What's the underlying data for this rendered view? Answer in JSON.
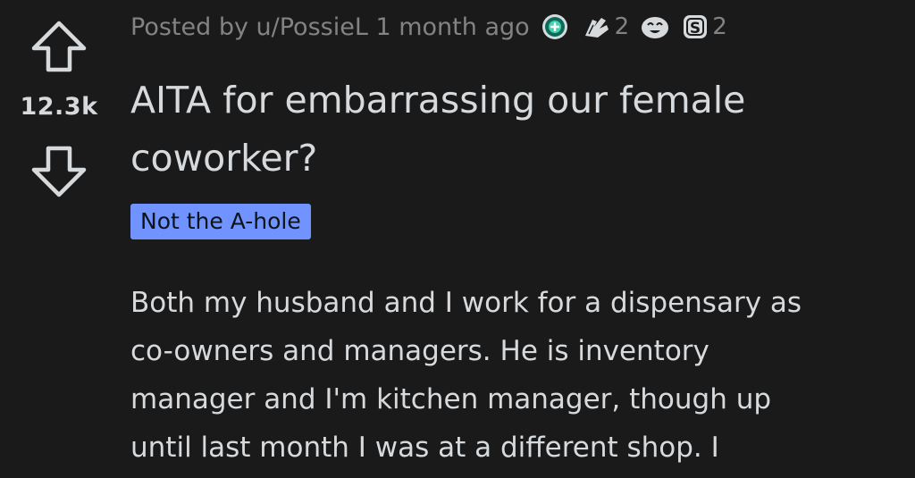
{
  "post": {
    "meta": {
      "posted_by": "Posted by u/PossieL",
      "time_ago": "1 month ago",
      "awards": [
        {
          "icon": "helpful-award-icon",
          "count": ""
        },
        {
          "icon": "wholesome-hug-award-icon",
          "count": "2"
        },
        {
          "icon": "laughing-face-award-icon",
          "count": ""
        },
        {
          "icon": "silver-award-icon",
          "count": "2"
        }
      ]
    },
    "score": "12.3k",
    "title": "AITA for embarrassing our female coworker?",
    "flair": "Not the A-hole",
    "body_lines": [
      "Both my husband and I work for a dispensary as",
      "co-owners and managers. He is inventory",
      "manager and I'm kitchen manager, though up",
      "until last month I was at a different shop. I"
    ]
  },
  "colors": {
    "background": "#1a1a1b",
    "text": "#d7dadc",
    "meta_text": "#818384",
    "flair_bg": "#7193ff"
  }
}
